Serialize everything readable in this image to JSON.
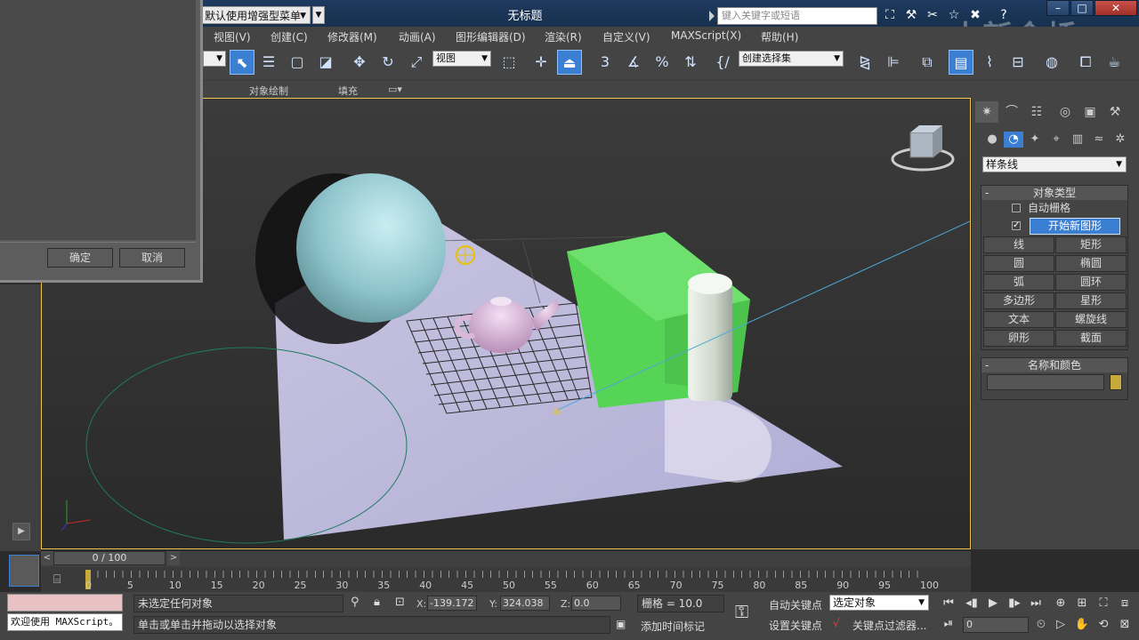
{
  "titlebar": {
    "workspace": "默认使用增强型菜单",
    "document_title": "无标题",
    "search_placeholder": "键入关键字或短语",
    "watermark": "中新金桥"
  },
  "menu": [
    "视图(V)",
    "创建(C)",
    "修改器(M)",
    "动画(A)",
    "图形编辑器(D)",
    "渲染(R)",
    "自定义(V)",
    "MAXScript(X)",
    "帮助(H)"
  ],
  "toolbar": {
    "ref_coord": "视图",
    "named_selection": "创建选择集",
    "snap_3": "3",
    "angle_snap": "%"
  },
  "ribbon": {
    "object_paint": "对象绘制",
    "fill": "填充"
  },
  "dialog": {
    "ok": "确定",
    "cancel": "取消"
  },
  "command_panel": {
    "category": "样条线",
    "object_type": {
      "title": "对象类型",
      "autogrid": "自动栅格",
      "start_new_shape": "开始新图形",
      "buttons": [
        "线",
        "矩形",
        "圆",
        "椭圆",
        "弧",
        "圆环",
        "多边形",
        "星形",
        "文本",
        "螺旋线",
        "卵形",
        "截面"
      ]
    },
    "name_color": {
      "title": "名称和颜色",
      "color": "#c8a93b"
    }
  },
  "timeline": {
    "position": "0 / 100",
    "ticks": [
      "0",
      "5",
      "10",
      "15",
      "20",
      "25",
      "30",
      "35",
      "40",
      "45",
      "50",
      "55",
      "60",
      "65",
      "70",
      "75",
      "80",
      "85",
      "90",
      "95",
      "100"
    ]
  },
  "statusbar": {
    "maxscript": "欢迎使用 MAXScript。",
    "selection_status": "未选定任何对象",
    "prompt": "单击或单击并拖动以选择对象",
    "x_label": "X:",
    "x_value": "-139.172",
    "y_label": "Y:",
    "y_value": "324.038",
    "z_label": "Z:",
    "z_value": "0.0",
    "grid": "栅格 = 10.0",
    "add_time_tag": "添加时间标记",
    "auto_key": "自动关键点",
    "set_key": "设置关键点",
    "selected": "选定对象",
    "key_filters": "关键点过滤器...",
    "frame": "0"
  }
}
